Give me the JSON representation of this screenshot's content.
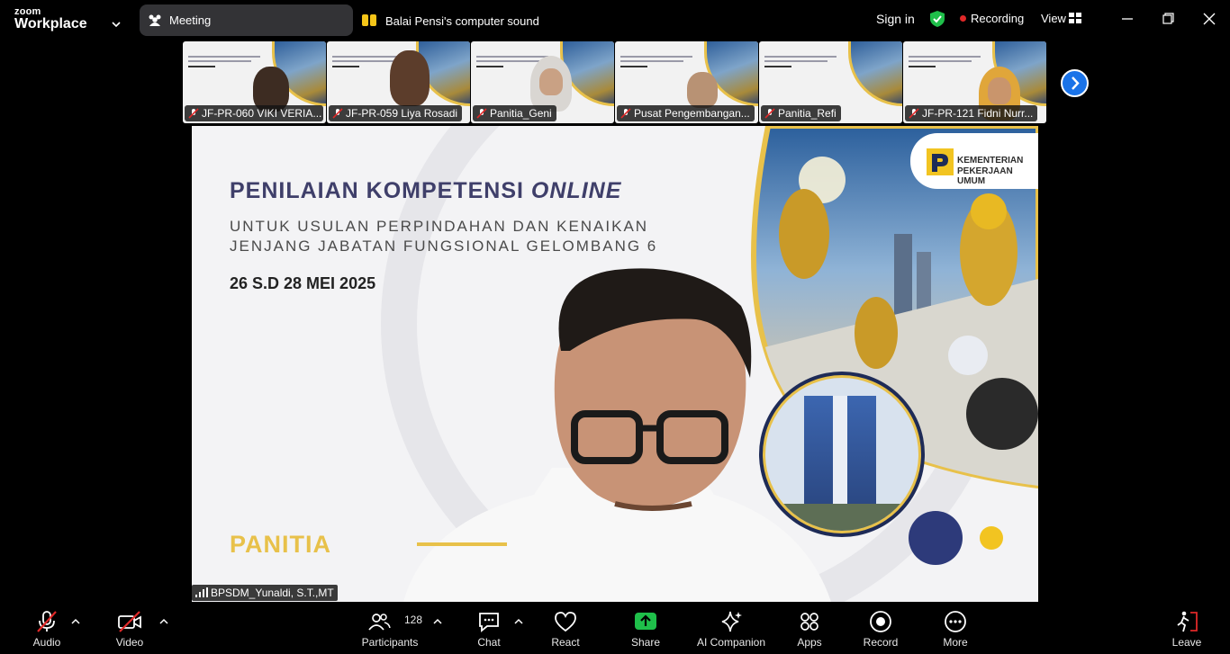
{
  "app": {
    "logo_small": "zoom",
    "logo_big": "Workplace"
  },
  "topbar": {
    "meeting_label": "Meeting",
    "sound_label": "Balai Pensi's computer sound",
    "signin": "Sign in",
    "recording": "Recording",
    "view": "View"
  },
  "thumbnails": [
    {
      "name": "JF-PR-060 VIKI VERIA..."
    },
    {
      "name": "JF-PR-059 Liya Rosadi"
    },
    {
      "name": "Panitia_Geni"
    },
    {
      "name": "Pusat Pengembangan..."
    },
    {
      "name": "Panitia_Refi"
    },
    {
      "name": "JF-PR-121 Fidni Nurr..."
    }
  ],
  "slide": {
    "title_main": "PENILAIAN KOMPETENSI ",
    "title_italic": "ONLINE",
    "subtitle_1": "UNTUK USULAN PERPINDAHAN DAN KENAIKAN",
    "subtitle_2": "JENJANG JABATAN FUNGSIONAL GELOMBANG 6",
    "date": "26 S.D 28 MEI 2025",
    "panitia": "PANITIA",
    "ministry_1": "KEMENTERIAN",
    "ministry_2": "PEKERJAAN UMUM"
  },
  "main_speaker": "BPSDM_Yunaldi, S.T.,MT",
  "toolbar": {
    "audio": "Audio",
    "video": "Video",
    "participants": "Participants",
    "participants_count": "128",
    "chat": "Chat",
    "react": "React",
    "share": "Share",
    "ai_companion": "AI Companion",
    "apps": "Apps",
    "record": "Record",
    "more": "More",
    "leave": "Leave"
  },
  "colors": {
    "share_green": "#1fbf4a",
    "recording_red": "#e02828",
    "accent_blue": "#1a73e8",
    "slide_yellow": "#e8c14a",
    "slide_navy": "#3f3f6a"
  }
}
